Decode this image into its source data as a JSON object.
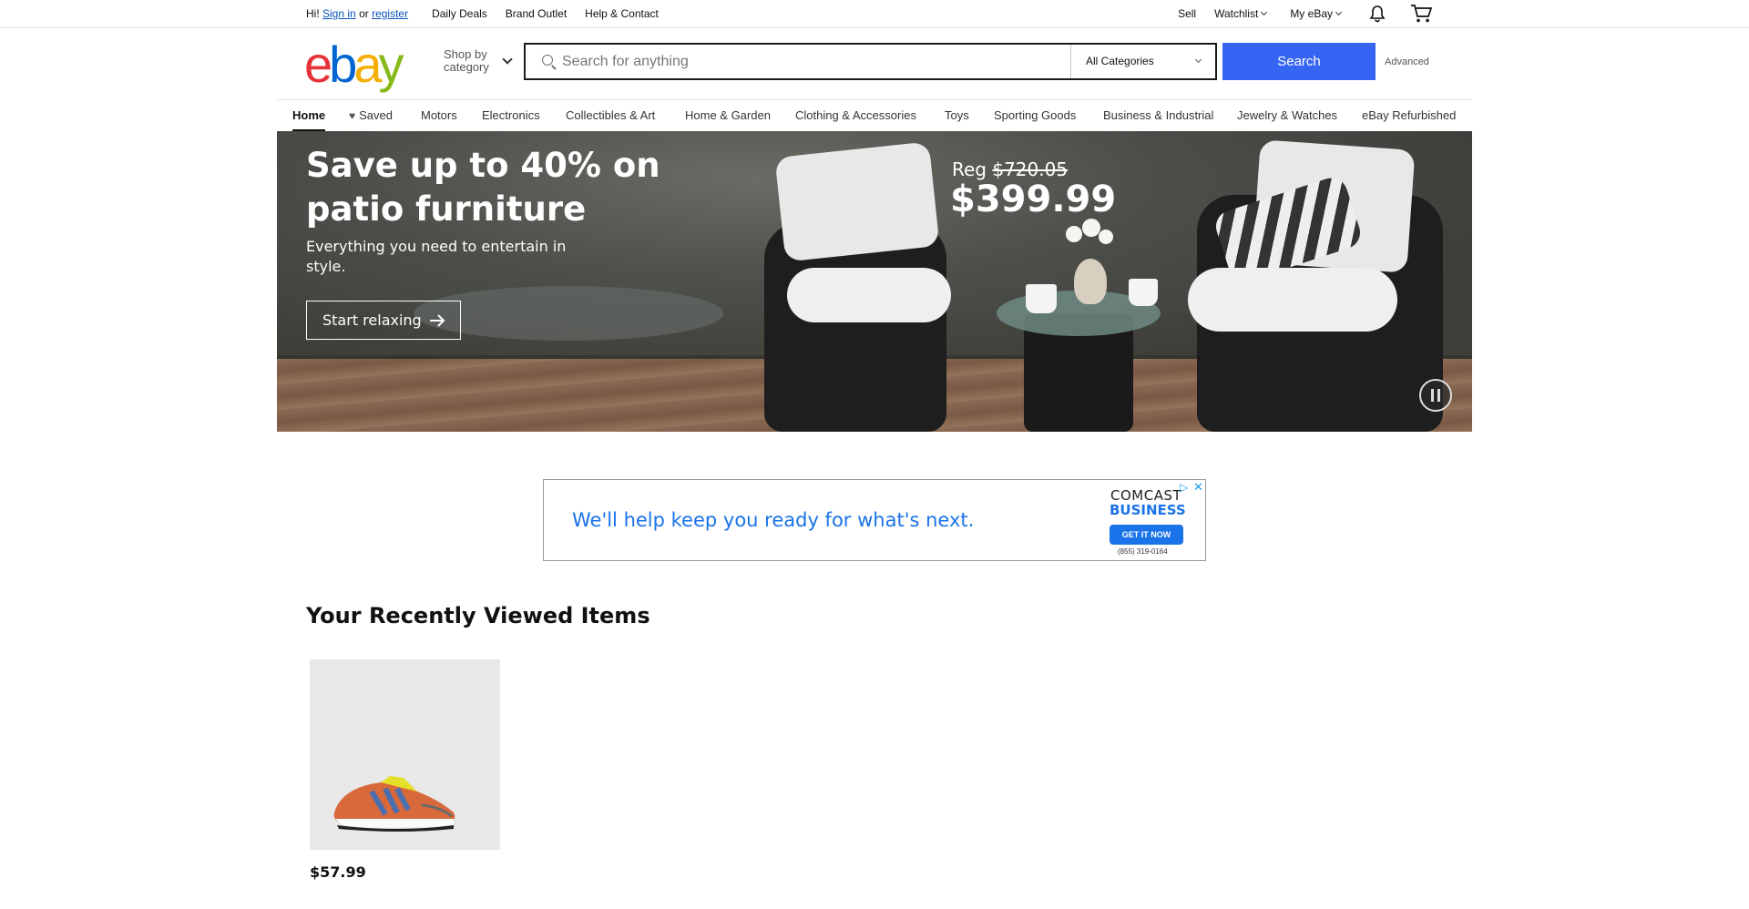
{
  "topbar": {
    "greeting": "Hi!",
    "sign_in": "Sign in",
    "or": "or",
    "register": "register",
    "links": [
      "Daily Deals",
      "Brand Outlet",
      "Help & Contact"
    ],
    "sell": "Sell",
    "watchlist": "Watchlist",
    "my_ebay": "My eBay"
  },
  "header": {
    "logo": {
      "e": "e",
      "b": "b",
      "a": "a",
      "y": "y"
    },
    "shop_by_category": "Shop by category",
    "search_placeholder": "Search for anything",
    "category_select": "All Categories",
    "search_button": "Search",
    "advanced": "Advanced"
  },
  "catnav": {
    "items": [
      "Home",
      "Saved",
      "Motors",
      "Electronics",
      "Collectibles & Art",
      "Home & Garden",
      "Clothing & Accessories",
      "Toys",
      "Sporting Goods",
      "Business & Industrial",
      "Jewelry & Watches",
      "eBay Refurbished"
    ]
  },
  "hero": {
    "title": "Save up to 40% on patio furniture",
    "subtitle": "Everything you need to entertain in style.",
    "cta": "Start relaxing",
    "reg_label": "Reg",
    "reg_price": "$720.05",
    "sale_price": "$399.99"
  },
  "ad": {
    "text": "We'll help keep you ready for what's next.",
    "brand_top": "COMCAST",
    "brand_bottom": "BUSINESS",
    "button": "GET IT NOW",
    "phone": "(855) 319-0164"
  },
  "recently_viewed": {
    "title": "Your Recently Viewed Items",
    "items": [
      {
        "price": "$57.99"
      }
    ]
  },
  "colors": {
    "search_button": "#3665f3",
    "link": "#0654ba",
    "logo_e": "#e53238",
    "logo_b": "#0064d2",
    "logo_a": "#f5af02",
    "logo_y": "#86b817",
    "ad_blue": "#1a73e8"
  }
}
